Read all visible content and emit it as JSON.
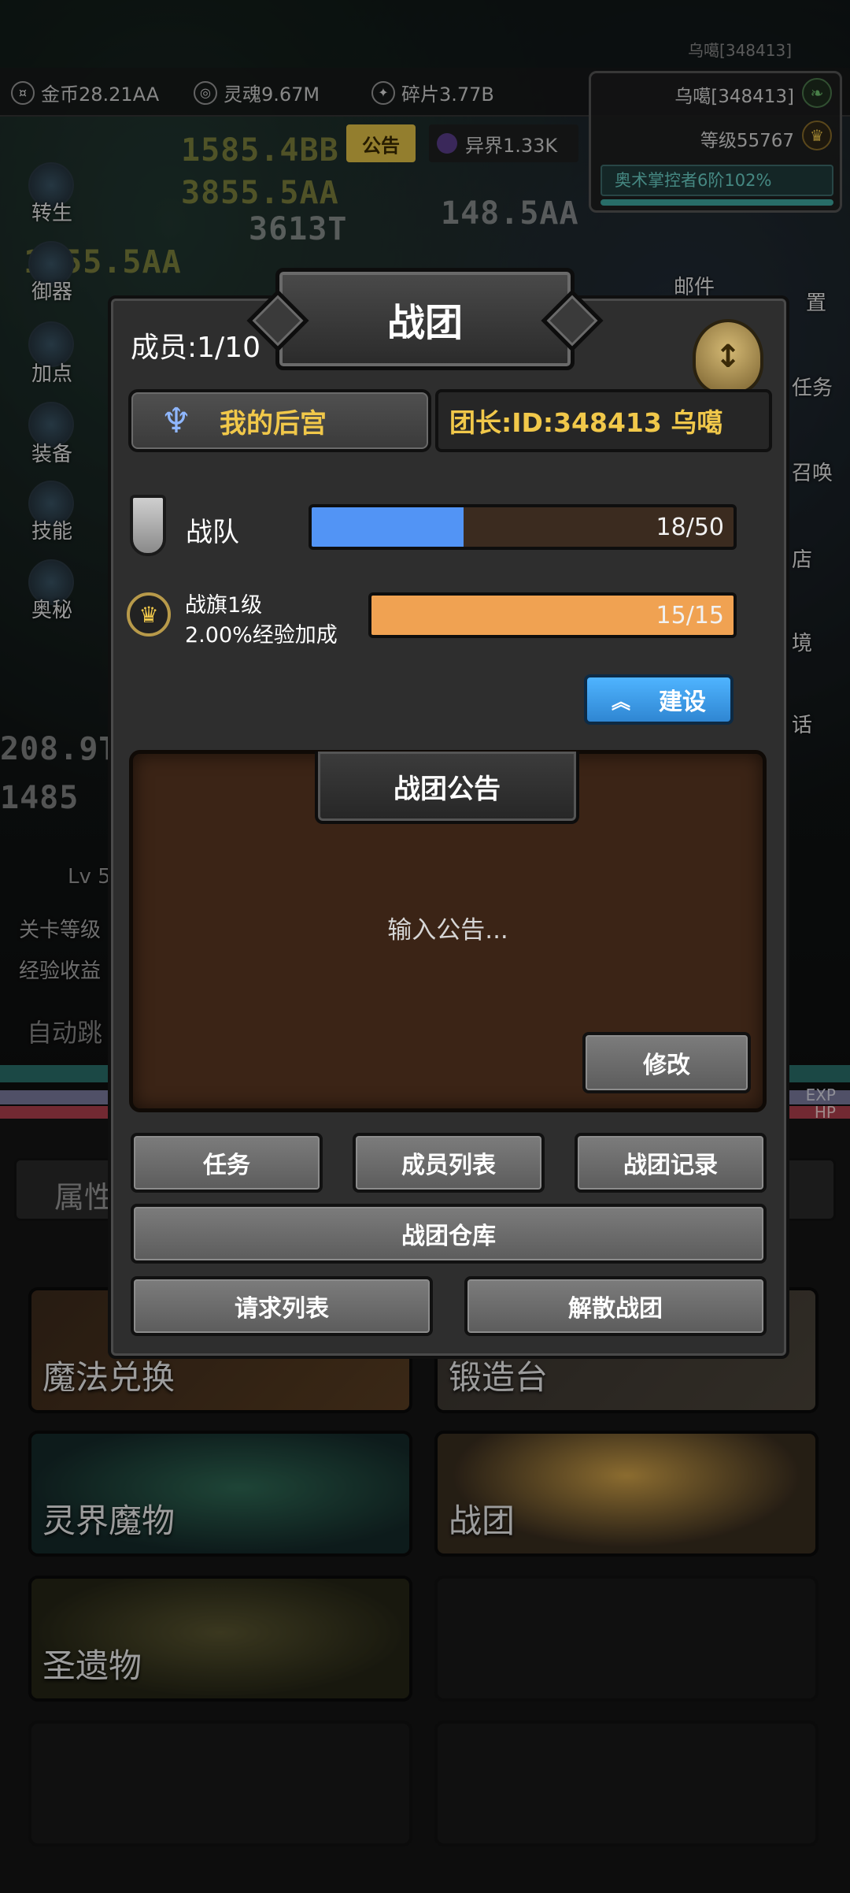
{
  "topbar": {
    "uid_label": "乌噶[348413]",
    "resources": [
      {
        "name": "gold",
        "icon": "coin-icon",
        "text": "金币28.21AA"
      },
      {
        "name": "soul",
        "icon": "soul-icon",
        "text": "灵魂9.67M"
      },
      {
        "name": "fragment",
        "icon": "fragment-icon",
        "text": "碎片3.77B"
      }
    ],
    "notice_tag": "公告",
    "otherworld": "异界1.33K"
  },
  "profile": {
    "name": "乌噶[348413]",
    "level": "等级55767",
    "title": "奥术掌控者6阶102%"
  },
  "background": {
    "floating_numbers": [
      "1585.4BB",
      "3855.5AA",
      "3613T",
      "148.5AA",
      "1855.5AA",
      "208.9T",
      "1485"
    ],
    "side_menu": [
      "转生",
      "御器",
      "加点",
      "装备",
      "技能",
      "奥秘"
    ],
    "right_menu": [
      "邮件",
      "置",
      "任务",
      "召唤",
      "店",
      "境",
      "话"
    ],
    "stage_lines": [
      "Lv 5",
      "关卡等级",
      "经验收益",
      "自动跳"
    ],
    "bar_tags": [
      "EXP",
      "HP"
    ],
    "attr_label": "属性",
    "menu_cards": [
      {
        "label": "魔法兑换"
      },
      {
        "label": "锻造台"
      },
      {
        "label": "灵界魔物"
      },
      {
        "label": "战团"
      },
      {
        "label": "圣遗物"
      }
    ]
  },
  "modal": {
    "title": "战团",
    "members": "成员:1/10",
    "guild_name": "我的后宫",
    "leader": "团长:ID:348413 乌噶",
    "team_label": "战队",
    "team_progress": {
      "text": "18/50",
      "current": 18,
      "max": 50
    },
    "flag_level": "战旗1级",
    "flag_bonus": "2.00%经验加成",
    "flag_progress": {
      "text": "15/15",
      "current": 15,
      "max": 15
    },
    "build_label": "建设",
    "notice_title": "战团公告",
    "notice_placeholder": "输入公告...",
    "edit_label": "修改",
    "buttons": {
      "task": "任务",
      "member_list": "成员列表",
      "record": "战团记录",
      "warehouse": "战团仓库",
      "requests": "请求列表",
      "disband": "解散战团"
    }
  },
  "colors": {
    "accent_gold": "#f1c84a",
    "team_bar": "#5294f5",
    "flag_bar": "#f0a252",
    "build_button": "#3a9be8"
  }
}
